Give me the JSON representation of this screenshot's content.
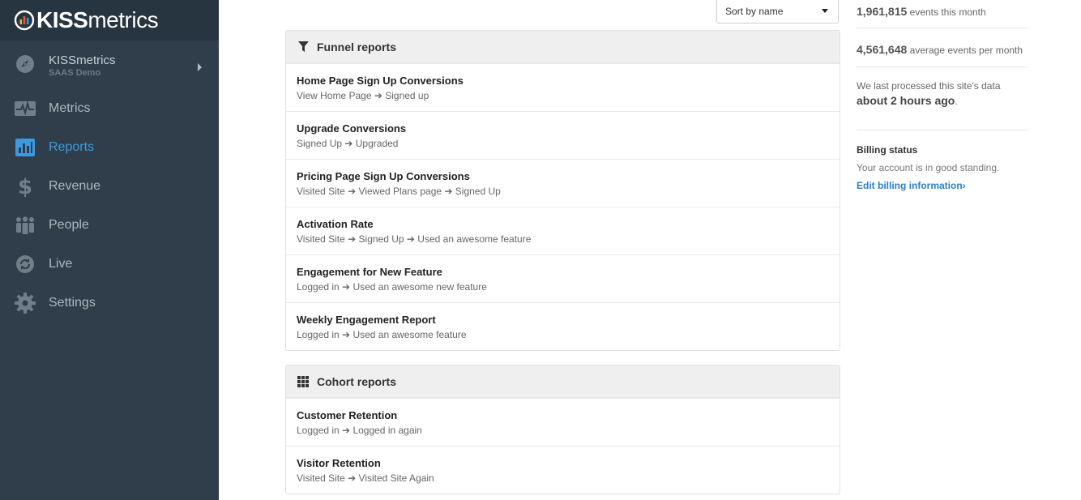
{
  "app": {
    "brand_bold": "KISS",
    "brand_light": "metrics",
    "brand_colors": [
      "#f6b13d",
      "#e9573f",
      "#3d9ae0"
    ]
  },
  "sidebar": {
    "site": {
      "name": "KISSmetrics",
      "subtitle": "SAAS Demo",
      "icon": "compass-icon"
    },
    "items": [
      {
        "label": "Metrics",
        "icon": "pulse-icon",
        "active": false
      },
      {
        "label": "Reports",
        "icon": "bar-chart-icon",
        "active": true
      },
      {
        "label": "Revenue",
        "icon": "dollar-icon",
        "active": false
      },
      {
        "label": "People",
        "icon": "people-icon",
        "active": false
      },
      {
        "label": "Live",
        "icon": "refresh-icon",
        "active": false
      },
      {
        "label": "Settings",
        "icon": "gear-icon",
        "active": false
      }
    ]
  },
  "toolbar": {
    "sort_value": "Sort by name"
  },
  "funnel": {
    "title": "Funnel reports",
    "rows": [
      {
        "title": "Home Page Sign Up Conversions",
        "steps": "View Home Page ➔ Signed up"
      },
      {
        "title": "Upgrade Conversions",
        "steps": "Signed Up ➔ Upgraded"
      },
      {
        "title": "Pricing Page Sign Up Conversions",
        "steps": "Visited Site ➔ Viewed Plans page ➔ Signed Up"
      },
      {
        "title": "Activation Rate",
        "steps": "Visited Site ➔ Signed Up ➔ Used an awesome feature"
      },
      {
        "title": "Engagement for New Feature",
        "steps": "Logged in ➔ Used an awesome new feature"
      },
      {
        "title": "Weekly Engagement Report",
        "steps": "Logged in ➔ Used an awesome feature"
      }
    ]
  },
  "cohort": {
    "title": "Cohort reports",
    "rows": [
      {
        "title": "Customer Retention",
        "steps": "Logged in ➔ Logged in again"
      },
      {
        "title": "Visitor Retention",
        "steps": "Visited Site ➔ Visited Site Again"
      }
    ]
  },
  "stats": {
    "events_month_value": "1,961,815",
    "events_month_label": "events this month",
    "avg_value": "4,561,648",
    "avg_label": "average events per month",
    "processed_text": "We last processed this site's data",
    "processed_time": "about 2 hours ago",
    "processed_suffix": "."
  },
  "billing": {
    "title": "Billing status",
    "text": "Your account is in good standing.",
    "link": "Edit billing information›"
  },
  "colors": {
    "accent": "#3d9ae0",
    "sidebar_bg": "#2f3e4a",
    "link": "#2a7fc9"
  }
}
